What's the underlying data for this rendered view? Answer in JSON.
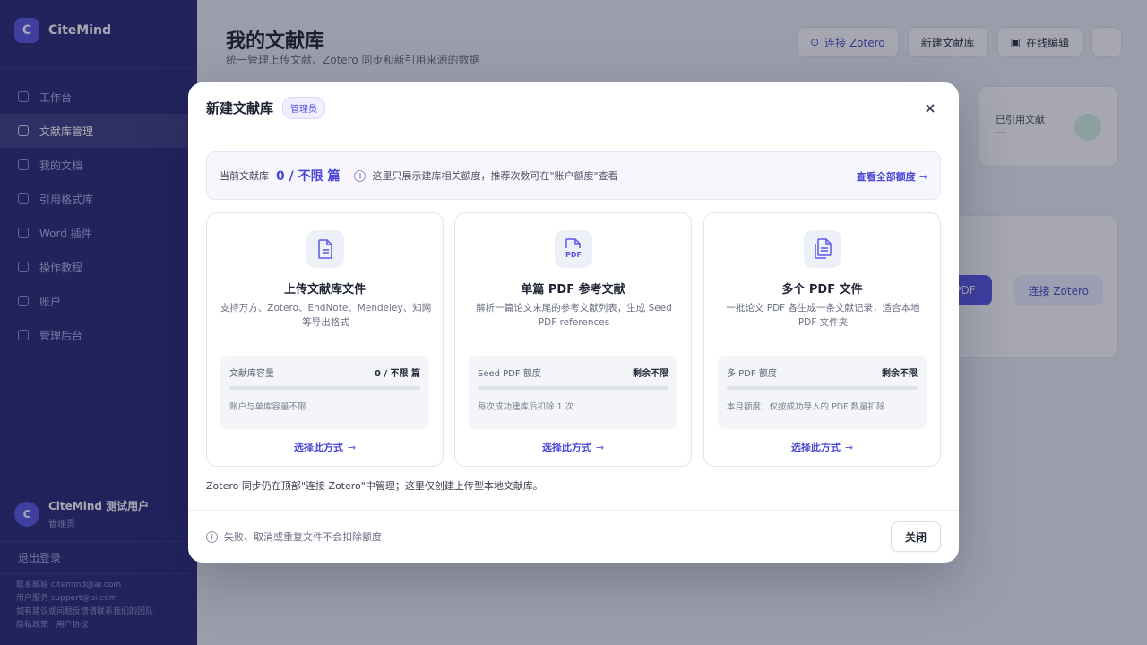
{
  "app": {
    "brand_initial": "C",
    "brand_name": "CiteMind",
    "nav": [
      "工作台",
      "文献库管理",
      "我的文档",
      "引用格式库",
      "Word 插件",
      "操作教程",
      "账户",
      "管理后台"
    ],
    "user_initial": "C",
    "user_name": "CiteMind 测试用户",
    "user_role": "管理员",
    "logout": "退出登录",
    "footer_lines": [
      "联系邮箱 citemind@ai.com",
      "用户服务 support@ai.com",
      "如有建议或问题反馈请联系我们的团队",
      "隐私政策 · 用户协议"
    ]
  },
  "page": {
    "title": "我的文献库",
    "subtitle": "统一管理上传文献、Zotero 同步和新引用来源的数据",
    "actions": {
      "connect_zotero": "连接 Zotero",
      "new_library": "新建文献库",
      "reference_list": "在线编辑"
    },
    "stat_label": "已引用文献",
    "stat_value": "—",
    "panel_primary": "PDF",
    "panel_ghost": "连接 Zotero"
  },
  "modal": {
    "title": "新建文献库",
    "role_badge": "管理员",
    "close_icon": "×",
    "quota": {
      "label": "当前文献库",
      "value": "0 / 不限 篇",
      "note": "这里只展示建库相关额度，推荐次数可在\"账户额度\"查看",
      "link": "查看全部额度"
    },
    "cards": [
      {
        "icon": "document-icon",
        "title": "上传文献库文件",
        "desc": "支持万方、Zotero、EndNote、Mendeley、知网等导出格式",
        "quota_label": "文献库容量",
        "quota_value": "0 / 不限 篇",
        "quota_fill": 0,
        "quota_note": "账户与单库容量不限",
        "action": "选择此方式"
      },
      {
        "icon": "pdf-icon",
        "title": "单篇 PDF 参考文献",
        "desc": "解析一篇论文末尾的参考文献列表，生成 Seed PDF references",
        "quota_label": "Seed PDF 额度",
        "quota_value": "剩余不限",
        "quota_fill": 0,
        "quota_note": "每次成功建库后扣除 1 次",
        "action": "选择此方式"
      },
      {
        "icon": "multi-files-icon",
        "title": "多个 PDF 文件",
        "desc": "一批论文 PDF 各生成一条文献记录，适合本地 PDF 文件夹",
        "quota_label": "多 PDF 额度",
        "quota_value": "剩余不限",
        "quota_fill": 0,
        "quota_note": "本月额度；仅按成功导入的 PDF 数量扣除",
        "action": "选择此方式"
      }
    ],
    "note": "Zotero 同步仍在顶部\"连接 Zotero\"中管理；这里仅创建上传型本地文献库。",
    "footer_note": "失败、取消或重复文件不会扣除额度",
    "close_button": "关闭",
    "info_glyph": "i",
    "arrow_glyph": "⇾"
  },
  "colors": {
    "accent": "#4b47d6",
    "sidebar": "#2a2b7a",
    "overlay": "rgba(20,23,48,0.38)"
  }
}
